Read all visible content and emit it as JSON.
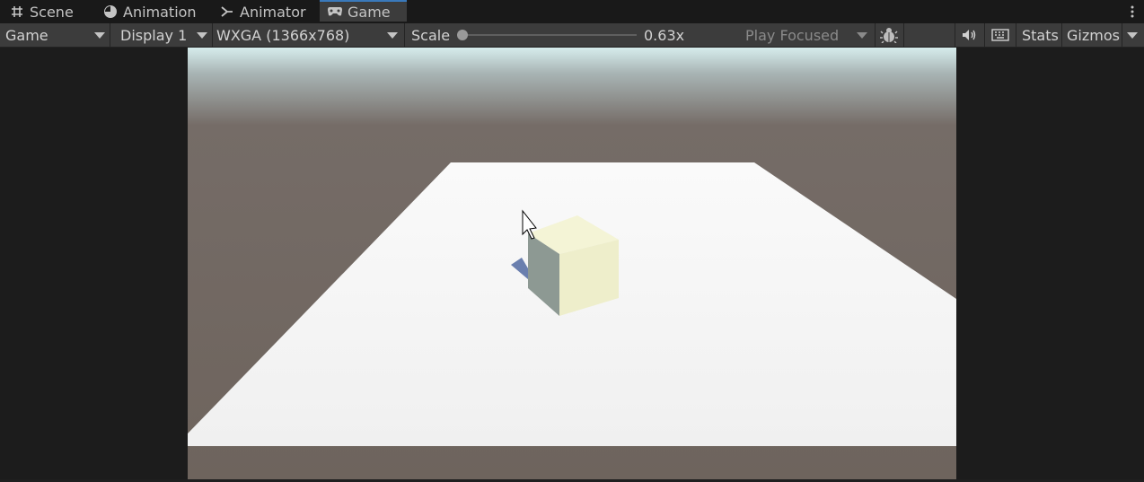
{
  "tabs": [
    {
      "label": "Scene",
      "icon": "grid-hash-icon",
      "active": false
    },
    {
      "label": "Animation",
      "icon": "clock-icon",
      "active": false
    },
    {
      "label": "Animator",
      "icon": "animator-nodes-icon",
      "active": false
    },
    {
      "label": "Game",
      "icon": "gamepad-icon",
      "active": true
    }
  ],
  "toolbar": {
    "view_mode": "Game",
    "display": "Display 1",
    "resolution": "WXGA (1366x768)",
    "scale_label": "Scale",
    "scale_value": "0.63x",
    "play_mode": "Play Focused",
    "stats_label": "Stats",
    "gizmos_label": "Gizmos",
    "scale_fraction": 0.0
  },
  "colors": {
    "accent": "#3a79bb",
    "toolbar_bg": "#3c3c3c",
    "tabbar_bg": "#191919",
    "sky_horizon": "#d6ecec",
    "ground": "#6e645d",
    "plane": "#f2f2f2",
    "cube_front": "#eeeecb",
    "cube_side": "#8d9993",
    "cube_top": "#f4f4d6",
    "shadow": "#6a7fae"
  },
  "icons": [
    "mute-audio-icon",
    "keyboard-icon",
    "bug-icon",
    "more-vertical-icon",
    "mouse-cursor-icon"
  ]
}
